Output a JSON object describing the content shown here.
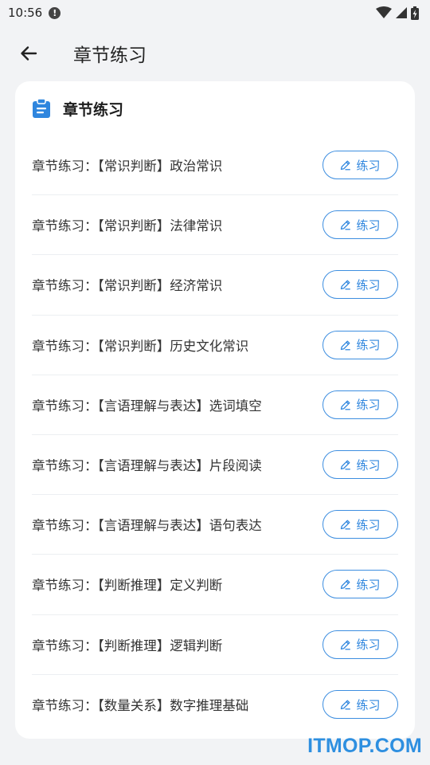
{
  "status_bar": {
    "time": "10:56",
    "alert_icon": "!",
    "icons": [
      "wifi-icon",
      "cell-signal-icon",
      "battery-icon"
    ]
  },
  "app_bar": {
    "back_icon": "arrow-left-icon",
    "title": "章节练习"
  },
  "card": {
    "icon": "clipboard-icon",
    "title": "章节练习",
    "accent_color": "#2f86de",
    "items": [
      {
        "label": "章节练习：【常识判断】政治常识",
        "button": "练习"
      },
      {
        "label": "章节练习：【常识判断】法律常识",
        "button": "练习"
      },
      {
        "label": "章节练习：【常识判断】经济常识",
        "button": "练习"
      },
      {
        "label": "章节练习：【常识判断】历史文化常识",
        "button": "练习"
      },
      {
        "label": "章节练习：【言语理解与表达】选词填空",
        "button": "练习"
      },
      {
        "label": "章节练习：【言语理解与表达】片段阅读",
        "button": "练习"
      },
      {
        "label": "章节练习：【言语理解与表达】语句表达",
        "button": "练习"
      },
      {
        "label": "章节练习：【判断推理】定义判断",
        "button": "练习"
      },
      {
        "label": "章节练习：【判断推理】逻辑判断",
        "button": "练习"
      },
      {
        "label": "章节练习：【数量关系】数字推理基础",
        "button": "练习"
      }
    ]
  },
  "watermark": "ITMOP.COM"
}
